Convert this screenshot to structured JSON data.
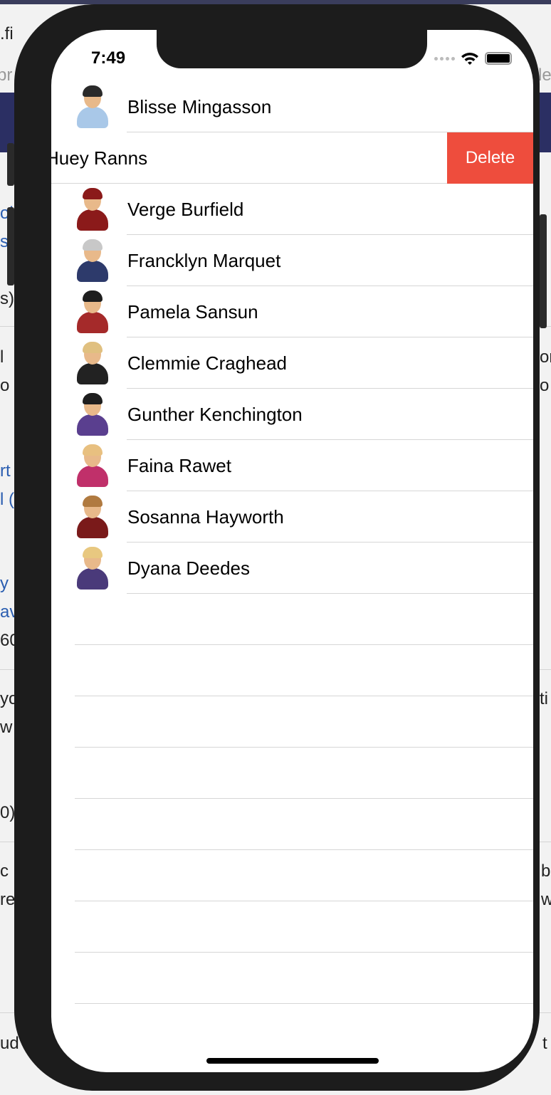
{
  "status_bar": {
    "time": "7:49"
  },
  "contacts": [
    {
      "name": "Blisse Mingasson",
      "hair": "#2a2a2a",
      "shirt": "#a9c8e8"
    },
    {
      "name": "Huey Ranns",
      "swiped": true
    },
    {
      "name": "Verge Burfield",
      "hair": "#8b1a1a",
      "shirt": "#8b1a1a"
    },
    {
      "name": "Francklyn Marquet",
      "hair": "#c8c8c8",
      "shirt": "#2d3a6b"
    },
    {
      "name": "Pamela Sansun",
      "hair": "#1e1e1e",
      "shirt": "#a52a2a"
    },
    {
      "name": "Clemmie Craghead",
      "hair": "#e0c080",
      "shirt": "#222222"
    },
    {
      "name": "Gunther Kenchington",
      "hair": "#1e1e1e",
      "shirt": "#5a3f8f"
    },
    {
      "name": "Faina Rawet",
      "hair": "#e8c080",
      "shirt": "#c0306a"
    },
    {
      "name": "Sosanna Hayworth",
      "hair": "#b07a40",
      "shirt": "#7a1a1a"
    },
    {
      "name": "Dyana Deedes",
      "hair": "#e8c880",
      "shirt": "#4a3a7a"
    }
  ],
  "swipe_action": {
    "label": "Delete",
    "color": "#ee4d3d"
  },
  "background_fragments": [
    ".fi",
    "pr",
    "le",
    "ob",
    "s",
    "s)",
    "l",
    "o y",
    "on",
    "o",
    "rt",
    "l (",
    "y l",
    "avi",
    "60",
    "yo",
    "ti",
    "w",
    "0)",
    "c",
    "b",
    "re",
    "w",
    "ud",
    "t"
  ]
}
